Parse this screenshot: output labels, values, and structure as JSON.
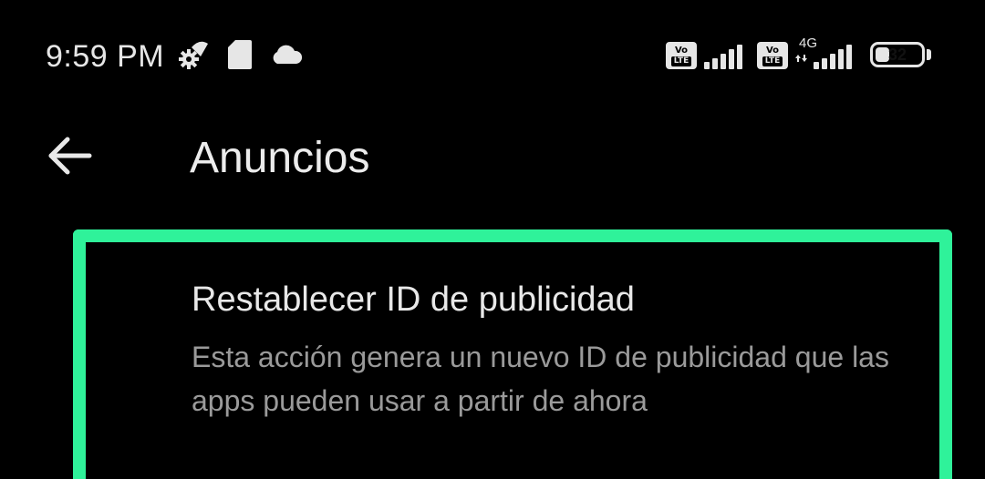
{
  "status_bar": {
    "time": "9:59 PM",
    "network_type": "4G",
    "battery_percent": "32",
    "battery_level": 0.32,
    "volte_top": "Vo",
    "volte_bottom": "LTE",
    "icons": [
      "gear-icon",
      "wifi-icon",
      "sd-card-icon",
      "cloud-icon",
      "volte-icon",
      "signal-icon",
      "volte-icon",
      "signal-icon",
      "battery-icon"
    ]
  },
  "app_bar": {
    "back_icon": "arrow-left-icon",
    "title": "Anuncios"
  },
  "setting": {
    "title": "Restablecer ID de publicidad",
    "summary": "Esta acción genera un nuevo ID de publicidad que las apps pueden usar a partir de ahora"
  },
  "colors": {
    "background": "#000000",
    "highlight": "#2ff29a",
    "primary_text": "#e8e8e8",
    "secondary_text": "#9a9a9a"
  }
}
